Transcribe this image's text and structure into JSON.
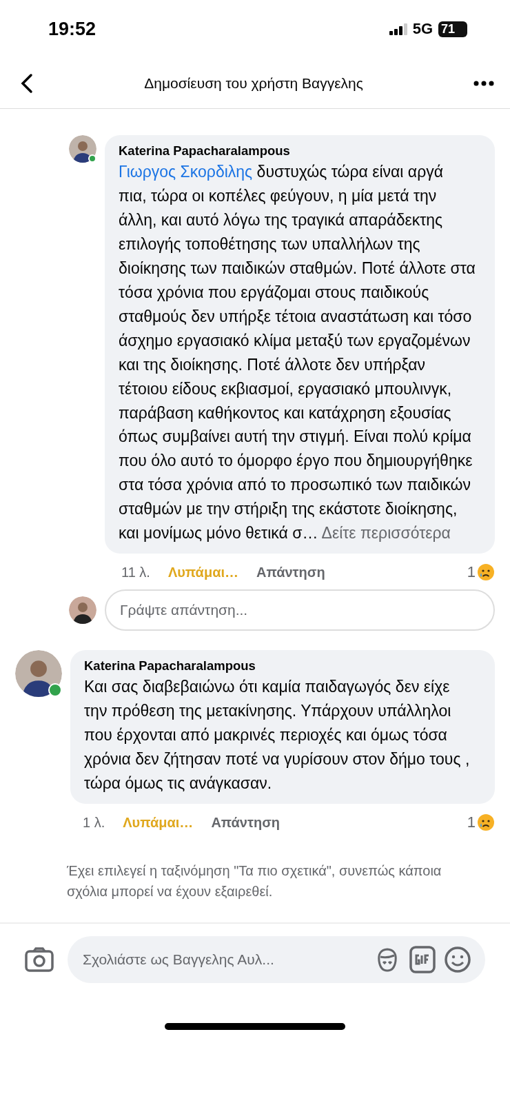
{
  "status_bar": {
    "time": "19:52",
    "network": "5G",
    "battery": "71"
  },
  "header": {
    "title": "Δημοσίευση του χρήστη Βαγγελης"
  },
  "comments": [
    {
      "kind": "reply",
      "author": "Katerina Papacharalampous",
      "online": true,
      "mention": "Γιωργος Σκορδιλης",
      "text": "δυστυχώς τώρα είναι αργά πια, τώρα οι κοπέλες φεύγουν, η μία μετά την άλλη, και αυτό λόγω της τραγικά απαράδεκτης επιλογής τοποθέτησης των υπαλλήλων της διοίκησης των παιδικών σταθμών. Ποτέ άλλοτε στα τόσα χρόνια που εργάζομαι στους παιδικούς σταθμούς δεν υπήρξε τέτοια αναστάτωση και τόσο άσχημο εργασιακό κλίμα μεταξύ των εργαζομένων και της διοίκησης. Ποτέ άλλοτε δεν υπήρξαν τέτοιου είδους εκβιασμοί, εργασιακό μπουλινγκ, παράβαση καθήκοντος και κατάχρηση εξουσίας όπως συμβαίνει αυτή την στιγμή. Είναι πολύ κρίμα που όλο αυτό το όμορφο έργο που δημιουργήθηκε στα τόσα χρόνια από το προσωπικό των παιδικών σταθμών με την στήριξη της εκάστοτε διοίκησης, και μονίμως μόνο θετικά σ…",
      "see_more": "Δείτε περισσότερα",
      "time": "11 λ.",
      "reaction": {
        "kind": "sad",
        "label": "Λυπάμαι…"
      },
      "reply": "Απάντηση",
      "count": "1",
      "composer": {
        "placeholder": "Γράψτε απάντηση..."
      }
    },
    {
      "kind": "top",
      "author": "Katerina Papacharalampous",
      "online": true,
      "text": "Και σας διαβεβαιώνω ότι καμία παιδαγωγός δεν είχε την πρόθεση της μετακίνησης. Υπάρχουν υπάλληλοι που έρχονται από μακρινές περιοχές και όμως τόσα χρόνια δεν ζήτησαν ποτέ να γυρίσουν στον δήμο τους , τώρα όμως τις ανάγκασαν.",
      "time": "1 λ.",
      "reaction": {
        "kind": "sad",
        "label": "Λυπάμαι…"
      },
      "reply": "Απάντηση",
      "count": "1"
    }
  ],
  "note": "Έχει επιλεγεί η ταξινόμηση \"Τα πιο σχετικά\", συνεπώς κάποια σχόλια μπορεί να έχουν εξαιρεθεί.",
  "composer": {
    "placeholder": "Σχολιάστε ως Βαγγελης Αυλ..."
  }
}
